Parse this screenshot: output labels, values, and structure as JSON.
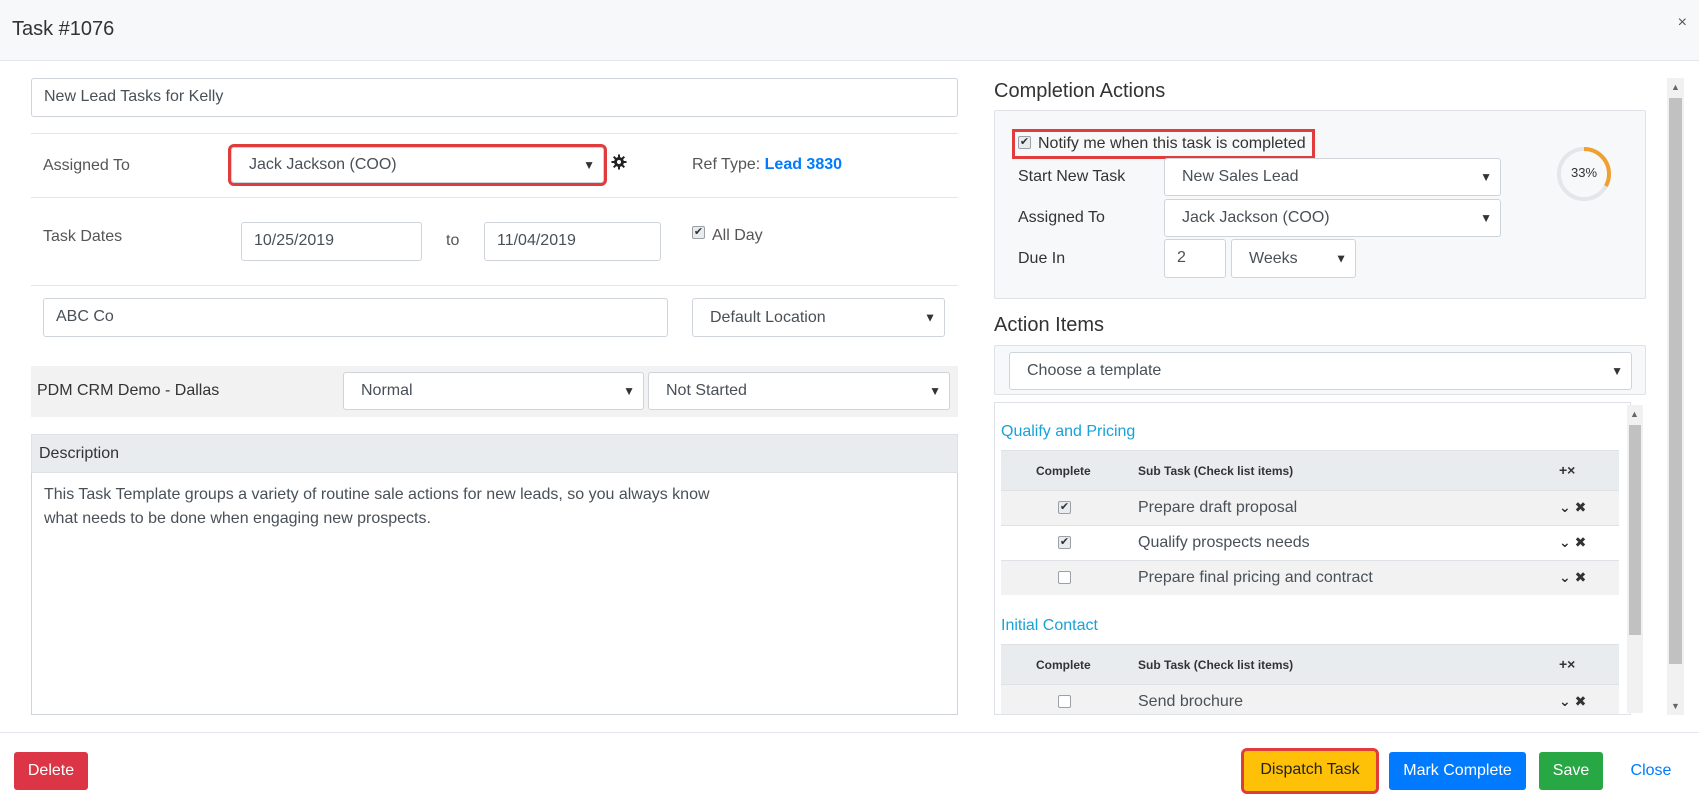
{
  "header": {
    "title": "Task #1076",
    "close_glyph": "×"
  },
  "task": {
    "title_value": "New Lead Tasks for Kelly",
    "assigned_to_label": "Assigned To",
    "assigned_to_value": "Jack Jackson (COO)",
    "ref_type_label": "Ref Type:",
    "ref_type_link": "Lead 3830",
    "task_dates_label": "Task Dates",
    "start_date": "10/25/2019",
    "to_label": "to",
    "end_date": "11/04/2019",
    "all_day_label": "All Day",
    "all_day_checked": true,
    "company_value": "ABC Co",
    "location_value": "Default Location",
    "org_label": "PDM CRM Demo - Dallas",
    "priority_value": "Normal",
    "status_value": "Not Started",
    "description_label": "Description",
    "description_lines": [
      "This Task Template groups a variety of routine sale actions for new leads, so you always know",
      "what needs to be done when engaging new prospects."
    ]
  },
  "completion": {
    "heading": "Completion Actions",
    "notify_label": "Notify me when this task is completed",
    "notify_checked": true,
    "start_new_task_label": "Start New Task",
    "start_new_task_value": "New Sales Lead",
    "assigned_to_label": "Assigned To",
    "assigned_to_value": "Jack Jackson (COO)",
    "due_in_label": "Due In",
    "due_in_value": "2",
    "due_in_unit": "Weeks",
    "progress_percent_text": "33%",
    "progress_fraction": 0.33,
    "progress_color": "#f0a030"
  },
  "action_items": {
    "heading": "Action Items",
    "template_placeholder": "Choose a template",
    "groups": [
      {
        "name": "Qualify and Pricing",
        "col_complete": "Complete",
        "col_subtask": "Sub Task (Check list items)",
        "head_icons": "+×",
        "items": [
          {
            "label": "Prepare draft proposal",
            "checked": true
          },
          {
            "label": "Qualify prospects needs",
            "checked": true
          },
          {
            "label": "Prepare final pricing and contract",
            "checked": false
          }
        ]
      },
      {
        "name": "Initial Contact",
        "col_complete": "Complete",
        "col_subtask": "Sub Task (Check list items)",
        "head_icons": "+×",
        "items": [
          {
            "label": "Send brochure",
            "checked": false
          }
        ]
      }
    ]
  },
  "footer": {
    "delete": "Delete",
    "dispatch": "Dispatch Task",
    "mark_complete": "Mark Complete",
    "save": "Save",
    "close": "Close"
  },
  "colors": {
    "link": "#007bff",
    "group_heading": "#17a2d8",
    "highlight": "#e03c3c"
  }
}
